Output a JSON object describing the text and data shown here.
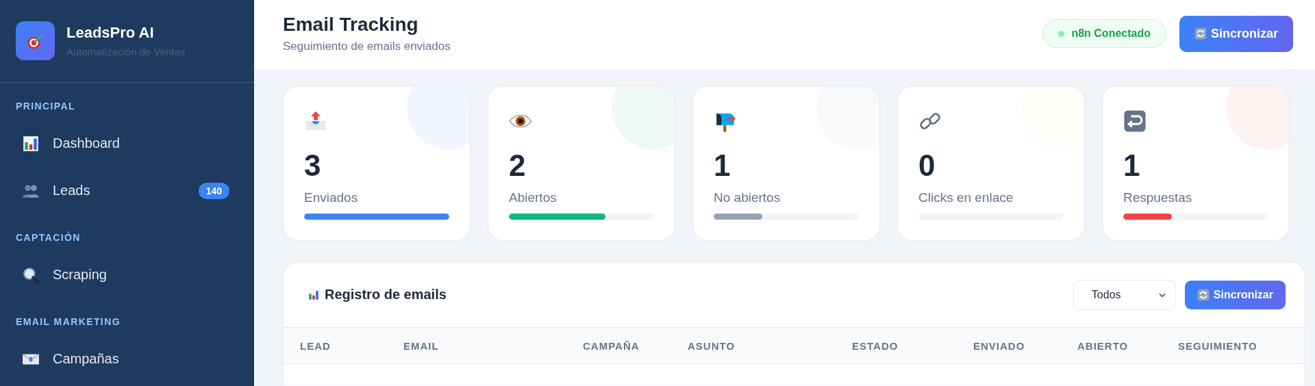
{
  "sidebar": {
    "brand": {
      "title": "LeadsPro AI",
      "subtitle": "Automatización de Ventas"
    },
    "sections": [
      {
        "title": "PRINCIPAL",
        "items": [
          {
            "label": "Dashboard",
            "selected": false
          },
          {
            "label": "Leads",
            "selected": false,
            "badge": "140"
          }
        ]
      },
      {
        "title": "CAPTACIÓN",
        "items": [
          {
            "label": "Scraping",
            "selected": false
          }
        ]
      },
      {
        "title": "EMAIL MARKETING",
        "items": [
          {
            "label": "Campañas",
            "selected": false
          }
        ]
      }
    ]
  },
  "header": {
    "title": "Email Tracking",
    "subtitle": "Seguimiento de emails enviados",
    "status": "n8n Conectado",
    "button": "Sincronizar"
  },
  "stats": [
    {
      "value": "3",
      "label": "Enviados",
      "level": 1,
      "color": "#3b82f6"
    },
    {
      "value": "2",
      "label": "Abiertos",
      "level": 0.667,
      "color": "#10b981"
    },
    {
      "value": "1",
      "label": "No abiertos",
      "level": 0.333,
      "color": "#94a3b8"
    },
    {
      "value": "0",
      "label": "Clicks en enlace",
      "level": 0
    },
    {
      "value": "1",
      "label": "Respuestas",
      "level": 0.333,
      "color": "#ef4444"
    }
  ],
  "table": {
    "title": "Registro de emails",
    "filter": "Todos",
    "button": "Sincronizar",
    "columns": [
      "LEAD",
      "EMAIL",
      "CAMPAÑA",
      "ASUNTO",
      "ESTADO",
      "ENVIADO",
      "ABIERTO",
      "SEGUIMIENTO"
    ]
  }
}
